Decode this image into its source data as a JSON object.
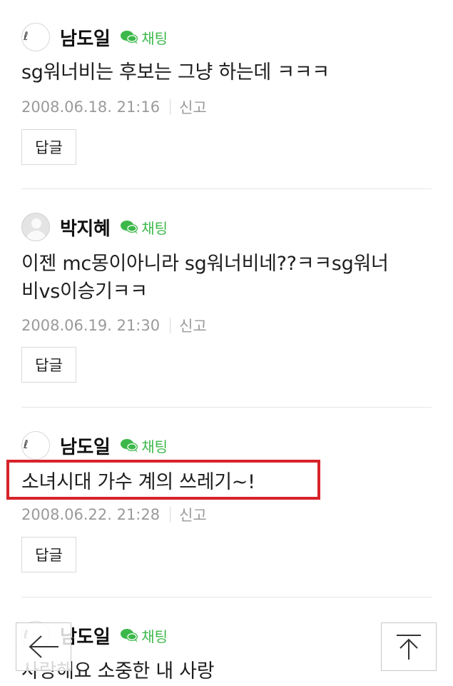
{
  "chat_label": "채팅",
  "report_label": "신고",
  "reply_label": "답글",
  "accent_color": "#3cb84a",
  "highlight_color": "#d8232a",
  "comments": [
    {
      "author": "남도일",
      "avatar": "custom-avatar",
      "text": "sg워너비는 후보는 그냥 하는데 ㅋㅋㅋ",
      "date": "2008.06.18. 21:16"
    },
    {
      "author": "박지혜",
      "avatar": "default-avatar",
      "text_line1": "이젠 mc몽이아니라 sg워너비네??ㅋㅋsg워너",
      "text_line2": "비vs이승기ㅋㅋ",
      "date": "2008.06.19. 21:30"
    },
    {
      "author": "남도일",
      "avatar": "custom-avatar",
      "text": "소녀시대 가수 계의 쓰레기~!",
      "date": "2008.06.22. 21:28",
      "highlighted": true
    },
    {
      "author": "남도일",
      "avatar": "custom-avatar",
      "text": "사랑해요 소중한 내 사랑"
    }
  ],
  "nav": {
    "back": "back-arrow-icon",
    "top": "scroll-to-top-icon"
  }
}
